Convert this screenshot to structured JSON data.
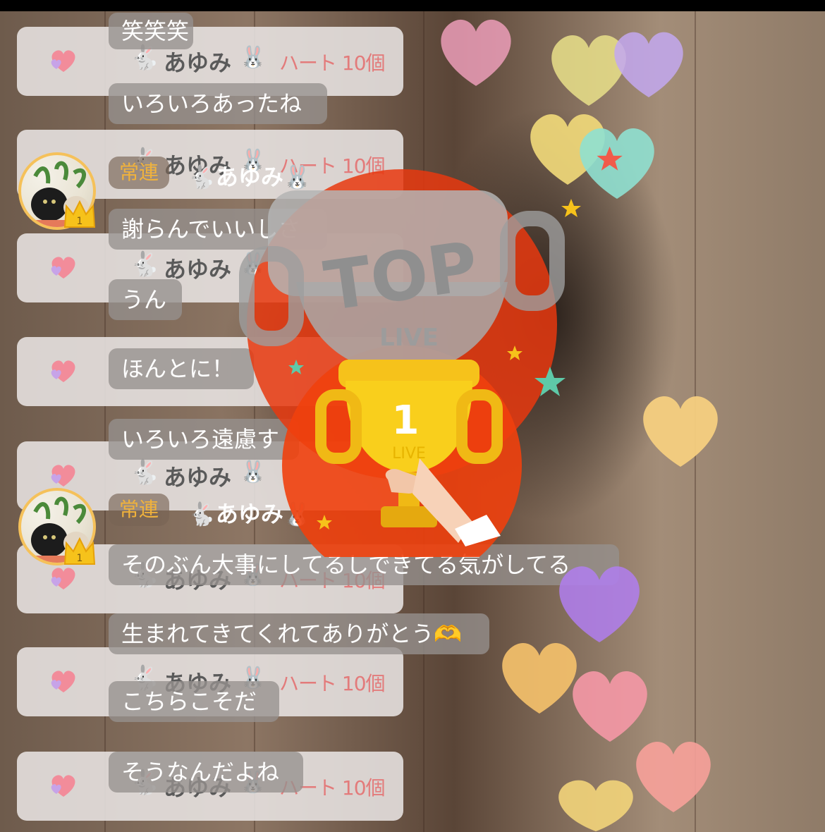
{
  "gift_rows": [
    {
      "name": "あゆみ",
      "emoji": "🐰",
      "text": "ハート 10個"
    },
    {
      "name": "あゆみ",
      "emoji": "🐰",
      "text": "ハート 10個"
    },
    {
      "name": "あゆみ",
      "emoji": "🐰",
      "text": ""
    },
    {
      "name": "",
      "emoji": "",
      "text": ""
    },
    {
      "name": "あゆみ",
      "emoji": "🐰",
      "text": ""
    },
    {
      "name": "あゆみ",
      "emoji": "🐰",
      "text": "ハート 10個"
    },
    {
      "name": "あゆみ",
      "emoji": "🐰",
      "text": "ハート 10個"
    },
    {
      "name": "あゆみ",
      "emoji": "🐰",
      "text": "ハート 10個"
    }
  ],
  "comments": [
    "笑笑笑",
    "いろいろあったね",
    "謝らんでいいしさ",
    "うん",
    "ほんとに！",
    "いろいろ遠慮す",
    "そのぶん大事にしてるしできてる気がしてる",
    "生まれてきてくれてありがとう🫶",
    "こちらこそだ",
    "そうなんだよね"
  ],
  "regulars": [
    {
      "tag": "常連",
      "name": "🐇あゆみ🐰",
      "rank": "1"
    },
    {
      "tag": "常連",
      "name": "🐇あゆみ🐰",
      "rank": "1"
    }
  ],
  "trophy": {
    "main": "TOP",
    "sub": "LIVE",
    "rank": "1",
    "rank_sub": "LIVE"
  },
  "colors": {
    "gift_text": "#e37b7b",
    "regular_tag": "#f0b23c",
    "trophy_red": "#e8380f",
    "gold": "#f6c21b"
  }
}
